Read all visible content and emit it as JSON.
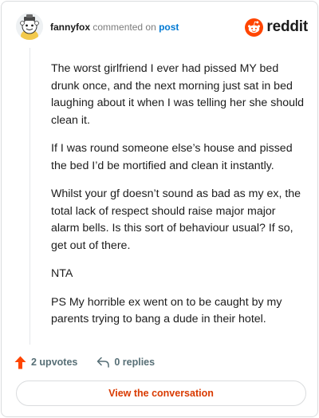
{
  "header": {
    "username": "fannyfox",
    "action_text": "commented on",
    "post_link_text": "post",
    "brand_text": "reddit"
  },
  "comment": {
    "paragraphs": [
      "The worst girlfriend I ever had pissed MY bed drunk once, and the next morning just sat in bed laughing about it when I was telling her she should clean it.",
      "If I was round someone else’s house and pissed the bed I’d be mortified and clean it instantly.",
      "Whilst your gf doesn’t sound as bad as my ex, the total lack of respect should raise major major alarm bells. Is this sort of behaviour usual? If so, get out of there.",
      "NTA",
      "PS My horrible ex went on to be caught by my parents trying to bang a dude in their hotel."
    ]
  },
  "actions": {
    "upvotes_label": "2 upvotes",
    "replies_label": "0 replies"
  },
  "cta": {
    "label": "View the conversation"
  },
  "colors": {
    "brand_orange": "#ff4500",
    "link_blue": "#0079d3",
    "cta_text": "#d93a00",
    "muted_text": "#576f76"
  },
  "icons": [
    "avatar-icon",
    "reddit-logo-icon",
    "upvote-arrow-icon",
    "reply-arrow-icon"
  ]
}
